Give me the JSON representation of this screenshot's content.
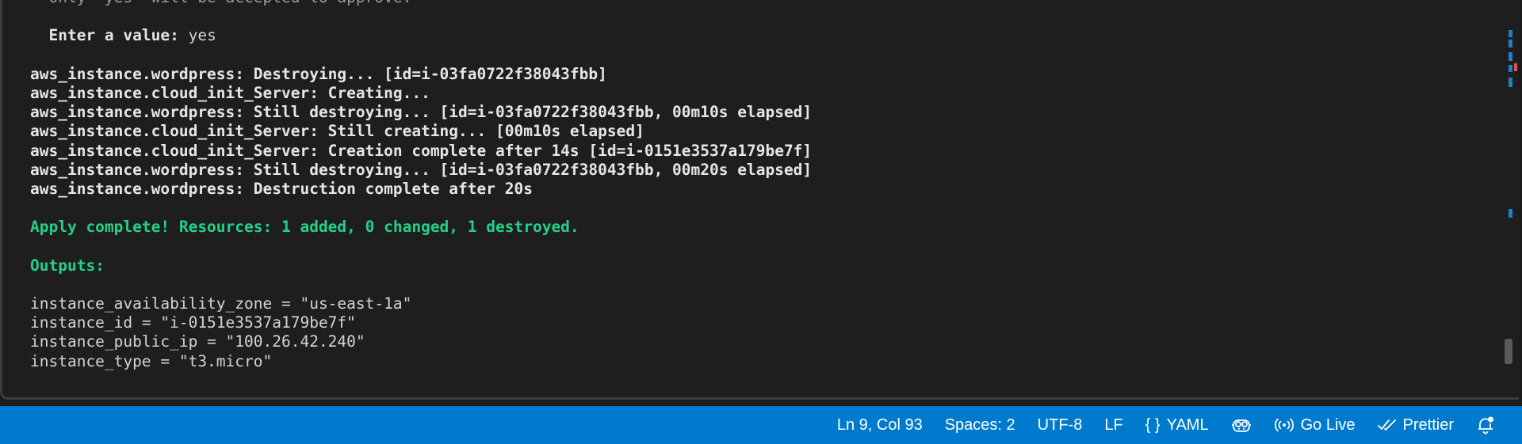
{
  "terminal": {
    "lines": [
      {
        "prefix": "",
        "text": "  Only 'yes' will be accepted to approve.",
        "style": "dim"
      },
      {
        "prefix": "",
        "text": "",
        "style": "normal"
      },
      {
        "prefix": "  Enter a value:",
        "text": " yes",
        "style": "prompt"
      },
      {
        "prefix": "",
        "text": "",
        "style": "normal"
      },
      {
        "prefix": "",
        "text": "aws_instance.wordpress: Destroying... [id=i-03fa0722f38043fbb]",
        "style": "bold"
      },
      {
        "prefix": "",
        "text": "aws_instance.cloud_init_Server: Creating...",
        "style": "bold"
      },
      {
        "prefix": "",
        "text": "aws_instance.wordpress: Still destroying... [id=i-03fa0722f38043fbb, 00m10s elapsed]",
        "style": "bold"
      },
      {
        "prefix": "",
        "text": "aws_instance.cloud_init_Server: Still creating... [00m10s elapsed]",
        "style": "bold"
      },
      {
        "prefix": "",
        "text": "aws_instance.cloud_init_Server: Creation complete after 14s [id=i-0151e3537a179be7f]",
        "style": "bold"
      },
      {
        "prefix": "",
        "text": "aws_instance.wordpress: Still destroying... [id=i-03fa0722f38043fbb, 00m20s elapsed]",
        "style": "bold"
      },
      {
        "prefix": "",
        "text": "aws_instance.wordpress: Destruction complete after 20s",
        "style": "bold"
      },
      {
        "prefix": "",
        "text": "",
        "style": "normal"
      },
      {
        "prefix": "",
        "text": "Apply complete! Resources: 1 added, 0 changed, 1 destroyed.",
        "style": "green"
      },
      {
        "prefix": "",
        "text": "",
        "style": "normal"
      },
      {
        "prefix": "",
        "text": "Outputs:",
        "style": "green"
      },
      {
        "prefix": "",
        "text": "",
        "style": "normal"
      },
      {
        "prefix": "",
        "text": "instance_availability_zone = \"us-east-1a\"",
        "style": "normal"
      },
      {
        "prefix": "",
        "text": "instance_id = \"i-0151e3537a179be7f\"",
        "style": "normal"
      },
      {
        "prefix": "",
        "text": "instance_public_ip = \"100.26.42.240\"",
        "style": "normal"
      },
      {
        "prefix": "",
        "text": "instance_type = \"t3.micro\"",
        "style": "normal"
      }
    ]
  },
  "colors": {
    "statusbar": "#007acc",
    "success": "#23d18b",
    "marker_blue": "#1f7fc0",
    "marker_red": "#e05252"
  },
  "statusbar": {
    "position": "Ln 9, Col 93",
    "indentation": "Spaces: 2",
    "encoding": "UTF-8",
    "eol": "LF",
    "language_icon": "{ }",
    "language": "YAML",
    "copilot_icon": "copilot-icon",
    "go_live_icon": "broadcast-icon",
    "go_live": "Go Live",
    "prettier_icon": "double-check-icon",
    "prettier": "Prettier",
    "notifications_icon": "bell-dot-icon"
  }
}
